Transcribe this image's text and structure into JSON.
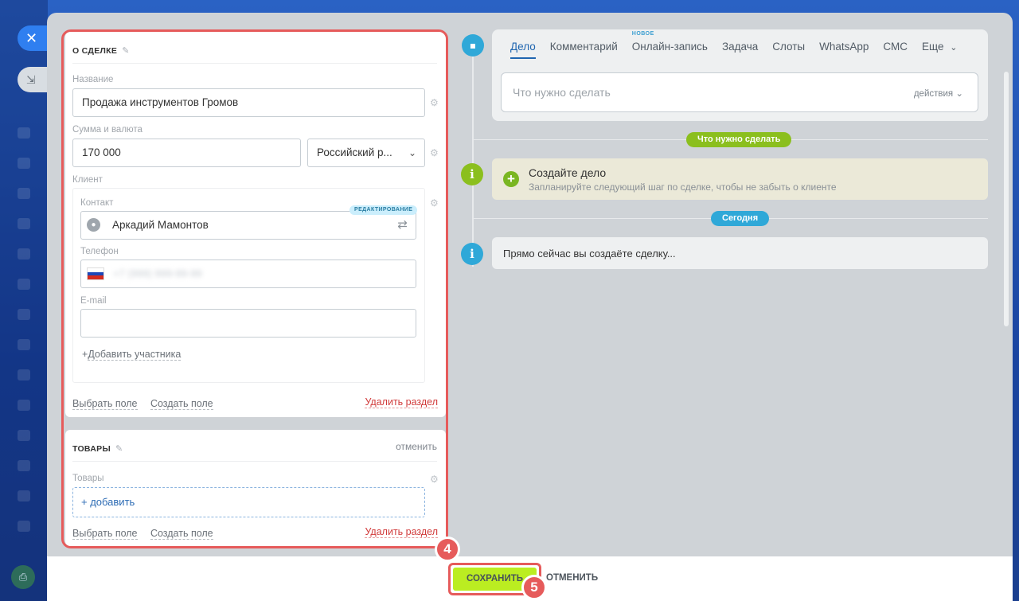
{
  "window": {
    "close_icon": "close-icon",
    "minimize_icon": "minimize-icon"
  },
  "deal_section": {
    "title": "О СДЕЛКЕ",
    "name_label": "Название",
    "name_value": "Продажа инструментов Громов",
    "amount_label": "Сумма и валюта",
    "amount_value": "170 000",
    "currency_value": "Российский р...",
    "client_label": "Клиент",
    "contact_label": "Контакт",
    "contact_badge": "РЕДАКТИРОВАНИЕ",
    "contact_value": "Аркадий Мамонтов",
    "phone_label": "Телефон",
    "phone_value": "+7 (999) 999-99-99",
    "email_label": "E-mail",
    "email_value": "",
    "add_participant": "Добавить участника",
    "add_participant_prefix": "+",
    "select_field": "Выбрать поле",
    "create_field": "Создать поле",
    "delete_section": "Удалить раздел"
  },
  "products_section": {
    "title": "ТОВАРЫ",
    "cancel": "отменить",
    "products_label": "Товары",
    "add": "+ добавить",
    "select_field": "Выбрать поле",
    "create_field": "Создать поле",
    "delete_section": "Удалить раздел"
  },
  "activity_editor": {
    "tabs": [
      {
        "label": "Дело",
        "active": true
      },
      {
        "label": "Комментарий"
      },
      {
        "label": "Онлайн-запись",
        "badge": "НОВОЕ"
      },
      {
        "label": "Задача"
      },
      {
        "label": "Слоты"
      },
      {
        "label": "WhatsApp"
      },
      {
        "label": "СМС"
      },
      {
        "label": "Еще"
      }
    ],
    "placeholder": "Что нужно сделать",
    "actions": "действия"
  },
  "timeline": {
    "todo_pill": "Что нужно сделать",
    "create_title": "Создайте дело",
    "create_subtitle": "Запланируйте следующий шаг по сделке, чтобы не забыть о клиенте",
    "today_pill": "Сегодня",
    "info_text": "Прямо сейчас вы создаёте сделку..."
  },
  "footer": {
    "save": "СОХРАНИТЬ",
    "cancel": "ОТМЕНИТЬ"
  },
  "steps": {
    "step4": "4",
    "step5": "5"
  },
  "colors": {
    "accent_blue": "#2066b0",
    "save_green": "#bbed21",
    "highlight_red": "#e65b5b",
    "todo_pill": "#8bbf1e",
    "today_pill": "#2fa8d8"
  }
}
